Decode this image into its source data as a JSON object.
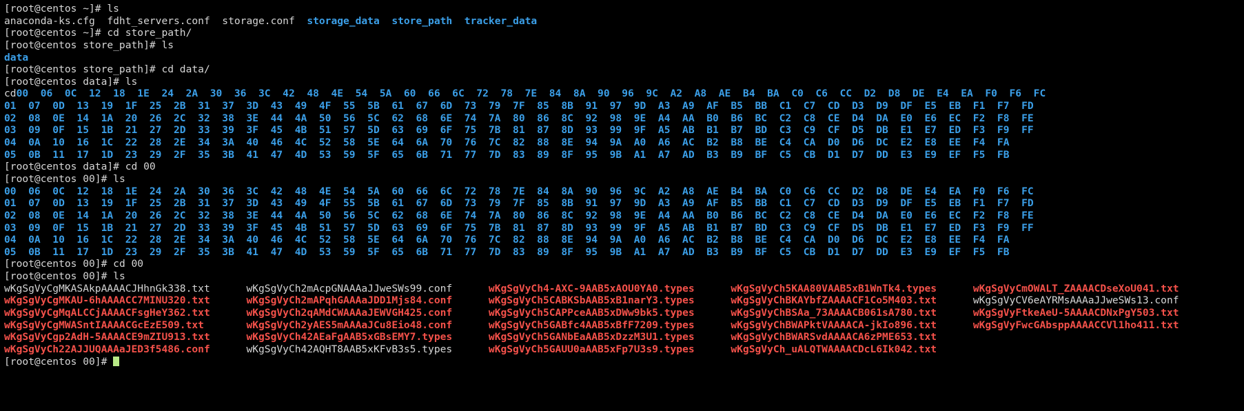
{
  "terminal": {
    "title": "root@centos terminal",
    "colors": {
      "background": "#000000",
      "foreground": "#d6d6d6",
      "directory": "#3b9fe8",
      "archive": "#f4514a",
      "cursor": "#b8e986"
    },
    "prompts": {
      "home": "[root@centos ~]# ",
      "store_path": "[root@centos store_path]# ",
      "data": "[root@centos data]# ",
      "dir00": "[root@centos 00]# "
    },
    "lines": [
      {
        "id": "l1",
        "type": "prompt",
        "prompt": "home",
        "command": "ls"
      },
      {
        "id": "l2",
        "type": "ls-home",
        "plain": "anaconda-ks.cfg  fdht_servers.conf  storage.conf  ",
        "dirs": [
          "storage_data",
          "store_path",
          "tracker_data"
        ]
      },
      {
        "id": "l3",
        "type": "prompt",
        "prompt": "home",
        "command": "cd store_path/"
      },
      {
        "id": "l4",
        "type": "prompt",
        "prompt": "store_path",
        "command": "ls"
      },
      {
        "id": "l5",
        "type": "ls-dir",
        "dirs": [
          "data"
        ]
      },
      {
        "id": "l6",
        "type": "prompt",
        "prompt": "store_path",
        "command": "cd data/"
      },
      {
        "id": "l7",
        "type": "prompt",
        "prompt": "data",
        "command": "ls"
      },
      {
        "id": "l8",
        "type": "hex-first"
      },
      {
        "id": "l9",
        "type": "hex",
        "row": 1
      },
      {
        "id": "l10",
        "type": "hex",
        "row": 2
      },
      {
        "id": "l11",
        "type": "hex",
        "row": 3
      },
      {
        "id": "l12",
        "type": "hex",
        "row": 4
      },
      {
        "id": "l13",
        "type": "hex",
        "row": 5
      },
      {
        "id": "l14",
        "type": "prompt",
        "prompt": "data",
        "command": "cd 00"
      },
      {
        "id": "l15",
        "type": "prompt",
        "prompt": "dir00",
        "command": "ls"
      },
      {
        "id": "l16",
        "type": "hex",
        "row": 0
      },
      {
        "id": "l17",
        "type": "hex",
        "row": 1
      },
      {
        "id": "l18",
        "type": "hex",
        "row": 2
      },
      {
        "id": "l19",
        "type": "hex",
        "row": 3
      },
      {
        "id": "l20",
        "type": "hex",
        "row": 4
      },
      {
        "id": "l21",
        "type": "hex",
        "row": 5
      },
      {
        "id": "l22",
        "type": "prompt",
        "prompt": "dir00",
        "command": "cd 00"
      },
      {
        "id": "l23",
        "type": "prompt",
        "prompt": "dir00",
        "command": "ls"
      },
      {
        "id": "l24",
        "type": "files",
        "row": 0
      },
      {
        "id": "l25",
        "type": "files",
        "row": 1
      },
      {
        "id": "l26",
        "type": "files",
        "row": 2
      },
      {
        "id": "l27",
        "type": "files",
        "row": 3
      },
      {
        "id": "l28",
        "type": "files",
        "row": 4
      },
      {
        "id": "l29",
        "type": "files",
        "row": 5
      },
      {
        "id": "l30",
        "type": "final-prompt",
        "prompt": "dir00"
      }
    ],
    "hex_grid": {
      "note": "ls output of 256 hex-named directories, 6 rows x 43 columns, column-major",
      "prefix_artifact": "cd",
      "rows": [
        [
          "00",
          "06",
          "0C",
          "12",
          "18",
          "1E",
          "24",
          "2A",
          "30",
          "36",
          "3C",
          "42",
          "48",
          "4E",
          "54",
          "5A",
          "60",
          "66",
          "6C",
          "72",
          "78",
          "7E",
          "84",
          "8A",
          "90",
          "96",
          "9C",
          "A2",
          "A8",
          "AE",
          "B4",
          "BA",
          "C0",
          "C6",
          "CC",
          "D2",
          "D8",
          "DE",
          "E4",
          "EA",
          "F0",
          "F6",
          "FC"
        ],
        [
          "01",
          "07",
          "0D",
          "13",
          "19",
          "1F",
          "25",
          "2B",
          "31",
          "37",
          "3D",
          "43",
          "49",
          "4F",
          "55",
          "5B",
          "61",
          "67",
          "6D",
          "73",
          "79",
          "7F",
          "85",
          "8B",
          "91",
          "97",
          "9D",
          "A3",
          "A9",
          "AF",
          "B5",
          "BB",
          "C1",
          "C7",
          "CD",
          "D3",
          "D9",
          "DF",
          "E5",
          "EB",
          "F1",
          "F7",
          "FD"
        ],
        [
          "02",
          "08",
          "0E",
          "14",
          "1A",
          "20",
          "26",
          "2C",
          "32",
          "38",
          "3E",
          "44",
          "4A",
          "50",
          "56",
          "5C",
          "62",
          "68",
          "6E",
          "74",
          "7A",
          "80",
          "86",
          "8C",
          "92",
          "98",
          "9E",
          "A4",
          "AA",
          "B0",
          "B6",
          "BC",
          "C2",
          "C8",
          "CE",
          "D4",
          "DA",
          "E0",
          "E6",
          "EC",
          "F2",
          "F8",
          "FE"
        ],
        [
          "03",
          "09",
          "0F",
          "15",
          "1B",
          "21",
          "27",
          "2D",
          "33",
          "39",
          "3F",
          "45",
          "4B",
          "51",
          "57",
          "5D",
          "63",
          "69",
          "6F",
          "75",
          "7B",
          "81",
          "87",
          "8D",
          "93",
          "99",
          "9F",
          "A5",
          "AB",
          "B1",
          "B7",
          "BD",
          "C3",
          "C9",
          "CF",
          "D5",
          "DB",
          "E1",
          "E7",
          "ED",
          "F3",
          "F9",
          "FF"
        ],
        [
          "04",
          "0A",
          "10",
          "16",
          "1C",
          "22",
          "28",
          "2E",
          "34",
          "3A",
          "40",
          "46",
          "4C",
          "52",
          "58",
          "5E",
          "64",
          "6A",
          "70",
          "76",
          "7C",
          "82",
          "88",
          "8E",
          "94",
          "9A",
          "A0",
          "A6",
          "AC",
          "B2",
          "B8",
          "BE",
          "C4",
          "CA",
          "D0",
          "D6",
          "DC",
          "E2",
          "E8",
          "EE",
          "F4",
          "FA"
        ],
        [
          "05",
          "0B",
          "11",
          "17",
          "1D",
          "23",
          "29",
          "2F",
          "35",
          "3B",
          "41",
          "47",
          "4D",
          "53",
          "59",
          "5F",
          "65",
          "6B",
          "71",
          "77",
          "7D",
          "83",
          "89",
          "8F",
          "95",
          "9B",
          "A1",
          "A7",
          "AD",
          "B3",
          "B9",
          "BF",
          "C5",
          "CB",
          "D1",
          "D7",
          "DD",
          "E3",
          "E9",
          "EF",
          "F5",
          "FB"
        ]
      ]
    },
    "file_listing": {
      "note": "ls output of /store_path/data/00/00 — FastDFS stored files, 6 rows x 5 columns",
      "columns": [
        {
          "width_chars": 40,
          "cells": [
            {
              "name": "wKgSgVyCgMKASAkpAAAACJHhnGk338.txt",
              "color": "white"
            },
            {
              "name": "wKgSgVyCgMKAU-6hAAAACC7MINU320.txt",
              "color": "red"
            },
            {
              "name": "wKgSgVyCgMqALCCjAAAACFsgHeY362.txt",
              "color": "red"
            },
            {
              "name": "wKgSgVyCgMWASntIAAAACGcEzE509.txt",
              "color": "red"
            },
            {
              "name": "wKgSgVyCgp2AdH-5AAAACE9mZIU913.txt",
              "color": "red"
            },
            {
              "name": "wKgSgVyCh22AJJUQAAAaJED3f5486.conf",
              "color": "red"
            }
          ]
        },
        {
          "width_chars": 40,
          "cells": [
            {
              "name": "wKgSgVyCh2mAcpGNAAAaJJweSWs99.conf",
              "color": "white"
            },
            {
              "name": "wKgSgVyCh2mAPqhGAAAaJDD1Mjs84.conf",
              "color": "red"
            },
            {
              "name": "wKgSgVyCh2qAMdCWAAAaJEWVGH425.conf",
              "color": "red"
            },
            {
              "name": "wKgSgVyCh2yAES5mAAAaJCu8Eio48.conf",
              "color": "red"
            },
            {
              "name": "wKgSgVyCh42AEaFgAAB5xGBsEMY7.types",
              "color": "red"
            },
            {
              "name": "wKgSgVyCh42AQHT8AAB5xKFvB3s5.types",
              "color": "white"
            }
          ]
        },
        {
          "width_chars": 40,
          "cells": [
            {
              "name": "wKgSgVyCh4-AXC-9AAB5xAOU0YA0.types",
              "color": "red"
            },
            {
              "name": "wKgSgVyCh5CABKSbAAB5xB1narY3.types",
              "color": "red"
            },
            {
              "name": "wKgSgVyCh5CAPPceAAB5xDWw9bk5.types",
              "color": "red"
            },
            {
              "name": "wKgSgVyCh5GABfc4AAB5xBfF7209.types",
              "color": "red"
            },
            {
              "name": "wKgSgVyCh5GANbEaAAB5xDzzM3U1.types",
              "color": "red"
            },
            {
              "name": "wKgSgVyCh5GAUU0aAAB5xFp7U3s9.types",
              "color": "red"
            }
          ]
        },
        {
          "width_chars": 40,
          "cells": [
            {
              "name": "wKgSgVyCh5KAA80VAAB5xB1WnTk4.types",
              "color": "red"
            },
            {
              "name": "wKgSgVyChBKAYbfZAAAACF1Co5M403.txt",
              "color": "red"
            },
            {
              "name": "wKgSgVyChBSAa_73AAAACB061sA780.txt",
              "color": "red"
            },
            {
              "name": "wKgSgVyChBWAPktVAAAACA-jkIo896.txt",
              "color": "red"
            },
            {
              "name": "wKgSgVyChBWARSvdAAAACA6zPME653.txt",
              "color": "red"
            },
            {
              "name": "wKgSgVyCh_uALQTWAAAACDcL6Ik042.txt",
              "color": "red"
            }
          ]
        },
        {
          "width_chars": 40,
          "cells": [
            {
              "name": "wKgSgVyCmOWALT_ZAAAACDseXoU041.txt",
              "color": "red"
            },
            {
              "name": "wKgSgVyCV6eAYRMsAAAaJJweSWs13.conf",
              "color": "white"
            },
            {
              "name": "wKgSgVyFtkeAeU-5AAAACDNxPgY503.txt",
              "color": "red"
            },
            {
              "name": "wKgSgVyFwcGAbsppAAAACCVl1ho411.txt",
              "color": "red"
            },
            {
              "name": "",
              "color": "white"
            },
            {
              "name": "",
              "color": "white"
            }
          ]
        }
      ]
    }
  }
}
